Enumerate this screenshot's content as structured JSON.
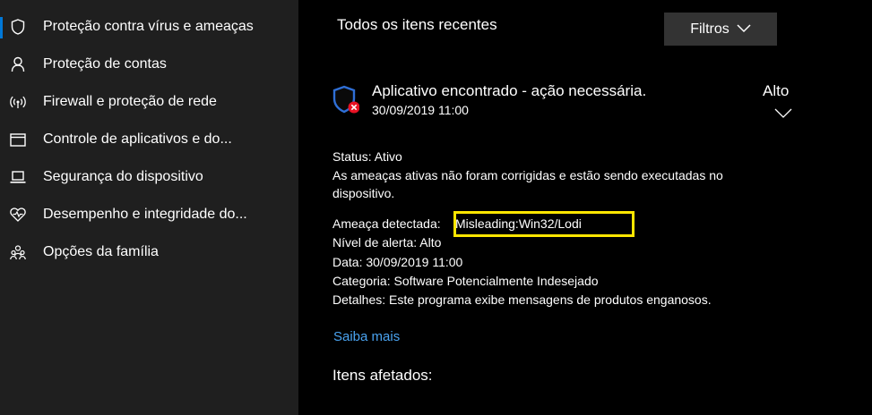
{
  "sidebar": {
    "items": [
      {
        "label": "Proteção contra vírus e ameaças",
        "icon": "shield-icon"
      },
      {
        "label": "Proteção de contas",
        "icon": "person-icon"
      },
      {
        "label": "Firewall e proteção de rede",
        "icon": "wireless-icon"
      },
      {
        "label": "Controle de aplicativos e do...",
        "icon": "app-window-icon"
      },
      {
        "label": "Segurança do dispositivo",
        "icon": "laptop-icon"
      },
      {
        "label": "Desempenho e integridade do...",
        "icon": "heart-pulse-icon"
      },
      {
        "label": "Opções da família",
        "icon": "family-icon"
      }
    ]
  },
  "main": {
    "section_title": "Todos os itens recentes",
    "filters_label": "Filtros",
    "threat": {
      "title": "Aplicativo encontrado - ação necessária.",
      "timestamp": "30/09/2019 11:00",
      "severity": "Alto",
      "status_label": "Status:",
      "status_value": "Ativo",
      "description_line1": "As ameaças ativas não foram corrigidas e estão sendo executadas no",
      "description_line2": "dispositivo.",
      "detected_label": "Ameaça detectada:",
      "detected_value": "Misleading:Win32/Lodi",
      "alert_label": "Nível de alerta:",
      "alert_value": "Alto",
      "date_label": "Data:",
      "date_value": "30/09/2019 11:00",
      "category_label": "Categoria:",
      "category_value": "Software Potencialmente Indesejado",
      "details_label": "Detalhes:",
      "details_value": "Este programa exibe mensagens de produtos enganosos."
    },
    "learn_more": "Saiba mais",
    "affected_items": "Itens afetados:"
  },
  "colors": {
    "accent": "#0078d7",
    "link": "#4aa3f0",
    "highlight": "#ffe600",
    "sidebar_bg": "#1f1f1f",
    "main_bg": "#000000"
  }
}
